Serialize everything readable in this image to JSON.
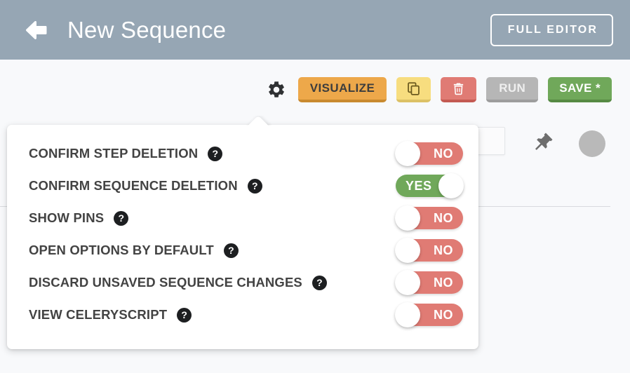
{
  "header": {
    "back_icon": "arrow-left-icon",
    "title": "New Sequence",
    "full_editor_label": "FULL EDITOR",
    "background_color": "#96a6b4"
  },
  "toolbar": {
    "gear_icon": "gear-icon",
    "visualize_label": "VISUALIZE",
    "copy_icon": "copy-icon",
    "delete_icon": "trash-icon",
    "run_label": "RUN",
    "save_label": "SAVE *",
    "colors": {
      "visualize": "#eda84a",
      "copy": "#f7dd7f",
      "delete": "#e07b74",
      "run": "#b6b6b6",
      "save": "#70a85a"
    }
  },
  "background": {
    "pin_icon": "pin-icon",
    "avatar_icon": "avatar-circle"
  },
  "popover": {
    "help_glyph": "?",
    "on_label": "YES",
    "off_label": "NO",
    "on_color": "#70a85a",
    "off_color": "#e07b74",
    "options": [
      {
        "label": "CONFIRM STEP DELETION",
        "value": "NO",
        "state": "off"
      },
      {
        "label": "CONFIRM SEQUENCE DELETION",
        "value": "YES",
        "state": "on"
      },
      {
        "label": "SHOW PINS",
        "value": "NO",
        "state": "off"
      },
      {
        "label": "OPEN OPTIONS BY DEFAULT",
        "value": "NO",
        "state": "off"
      },
      {
        "label": "DISCARD UNSAVED SEQUENCE CHANGES",
        "value": "NO",
        "state": "off"
      },
      {
        "label": "VIEW CELERYSCRIPT",
        "value": "NO",
        "state": "off"
      }
    ]
  }
}
